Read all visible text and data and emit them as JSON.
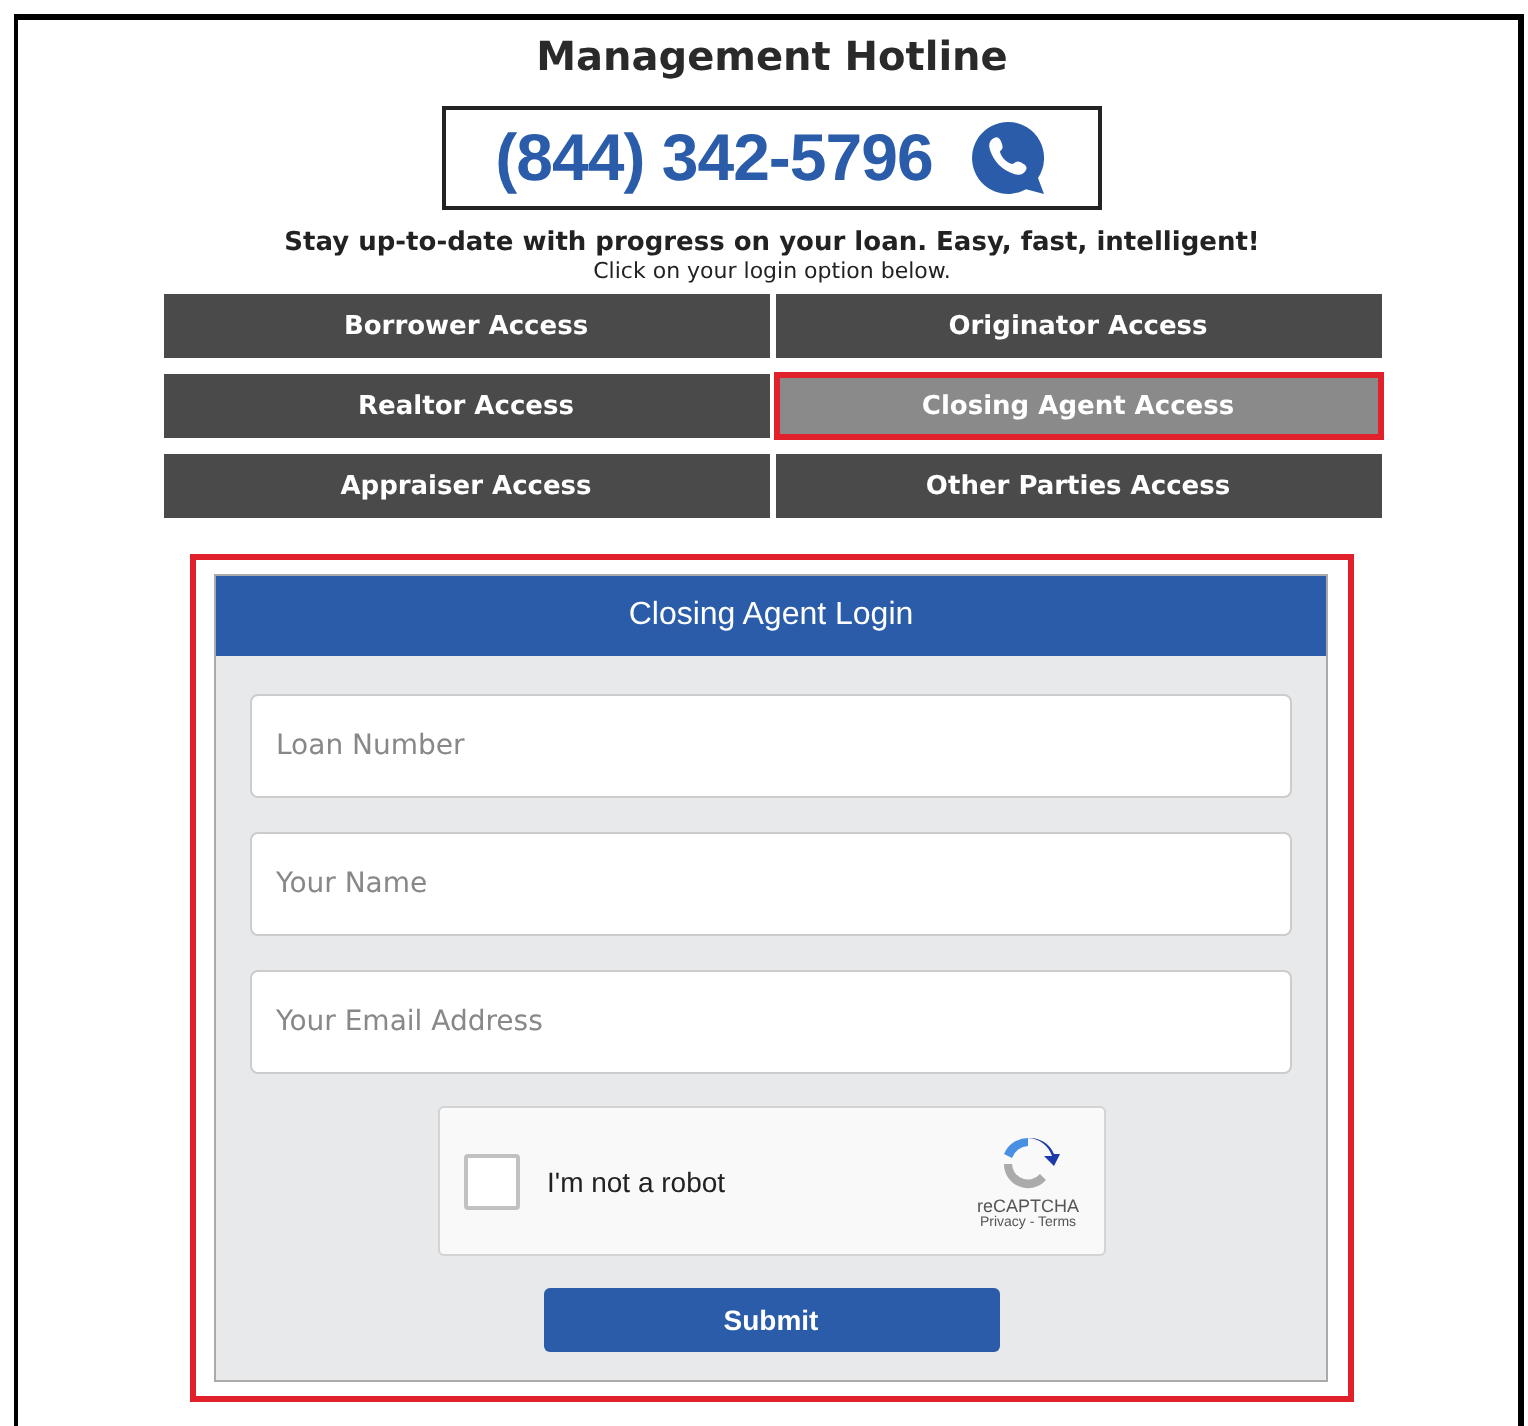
{
  "title": "Management Hotline",
  "phone": "(844) 342-5796",
  "tagline": "Stay up-to-date with progress on your loan. Easy, fast, intelligent!",
  "instruction": "Click on your login option below.",
  "access_buttons": [
    {
      "label": "Borrower Access",
      "selected": false
    },
    {
      "label": "Originator Access",
      "selected": false
    },
    {
      "label": "Realtor Access",
      "selected": false
    },
    {
      "label": "Closing Agent Access",
      "selected": true
    },
    {
      "label": "Appraiser Access",
      "selected": false
    },
    {
      "label": "Other Parties Access",
      "selected": false
    }
  ],
  "login": {
    "title": "Closing Agent Login",
    "fields": [
      {
        "placeholder": "Loan Number"
      },
      {
        "placeholder": "Your Name"
      },
      {
        "placeholder": "Your Email Address"
      }
    ],
    "captcha": {
      "label": "I'm not a robot",
      "checked": false,
      "brand": "reCAPTCHA",
      "links": "Privacy - Terms"
    },
    "submit": "Submit"
  }
}
